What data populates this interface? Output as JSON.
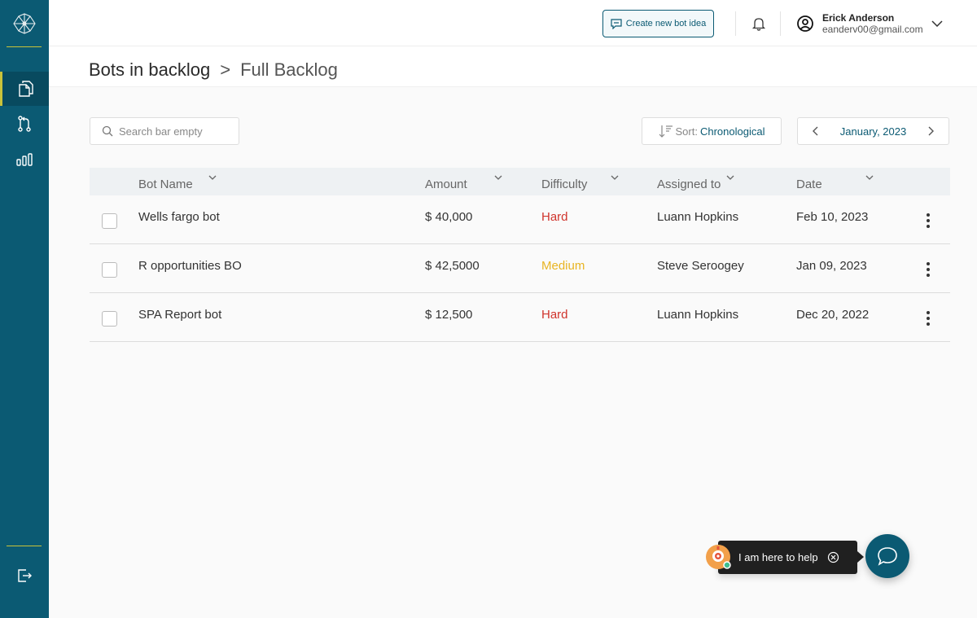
{
  "header": {
    "create_button_label": "Create new bot idea",
    "user": {
      "name": "Erick Anderson",
      "email": "eanderv00@gmail.com"
    }
  },
  "breadcrumb": {
    "parent": "Bots in backlog",
    "separator": ">",
    "current": "Full Backlog"
  },
  "toolbar": {
    "search_placeholder": "Search bar empty",
    "sort_label": "Sort:",
    "sort_value": "Chronological",
    "date_value": "January, 2023"
  },
  "table": {
    "columns": [
      "Bot Name",
      "Amount",
      "Difficulty",
      "Assigned to",
      "Date"
    ],
    "rows": [
      {
        "name": "Wells fargo bot",
        "amount": "$ 40,000",
        "difficulty": "Hard",
        "difficulty_color": "#d0342c",
        "assigned": "Luann Hopkins",
        "date": "Feb 10, 2023"
      },
      {
        "name": "R opportunities BO",
        "amount": "$ 42,5000",
        "difficulty": "Medium",
        "difficulty_color": "#e8b422",
        "assigned": "Steve Seroogey",
        "date": "Jan 09, 2023"
      },
      {
        "name": "SPA Report bot",
        "amount": "$ 12,500",
        "difficulty": "Hard",
        "difficulty_color": "#d0342c",
        "assigned": "Luann Hopkins",
        "date": "Dec 20, 2022"
      }
    ]
  },
  "help": {
    "text": "I am here to help"
  },
  "colors": {
    "brand": "#0b5a73",
    "accent": "#c9c23a",
    "hard": "#d0342c",
    "medium": "#e8b422"
  },
  "icons": {
    "sidebar": [
      "documents-icon",
      "merge-icon",
      "bar-chart-icon",
      "logout-icon"
    ],
    "header": [
      "chat-bubble-icon",
      "bell-icon",
      "user-circle-icon",
      "chevron-down-icon"
    ]
  }
}
